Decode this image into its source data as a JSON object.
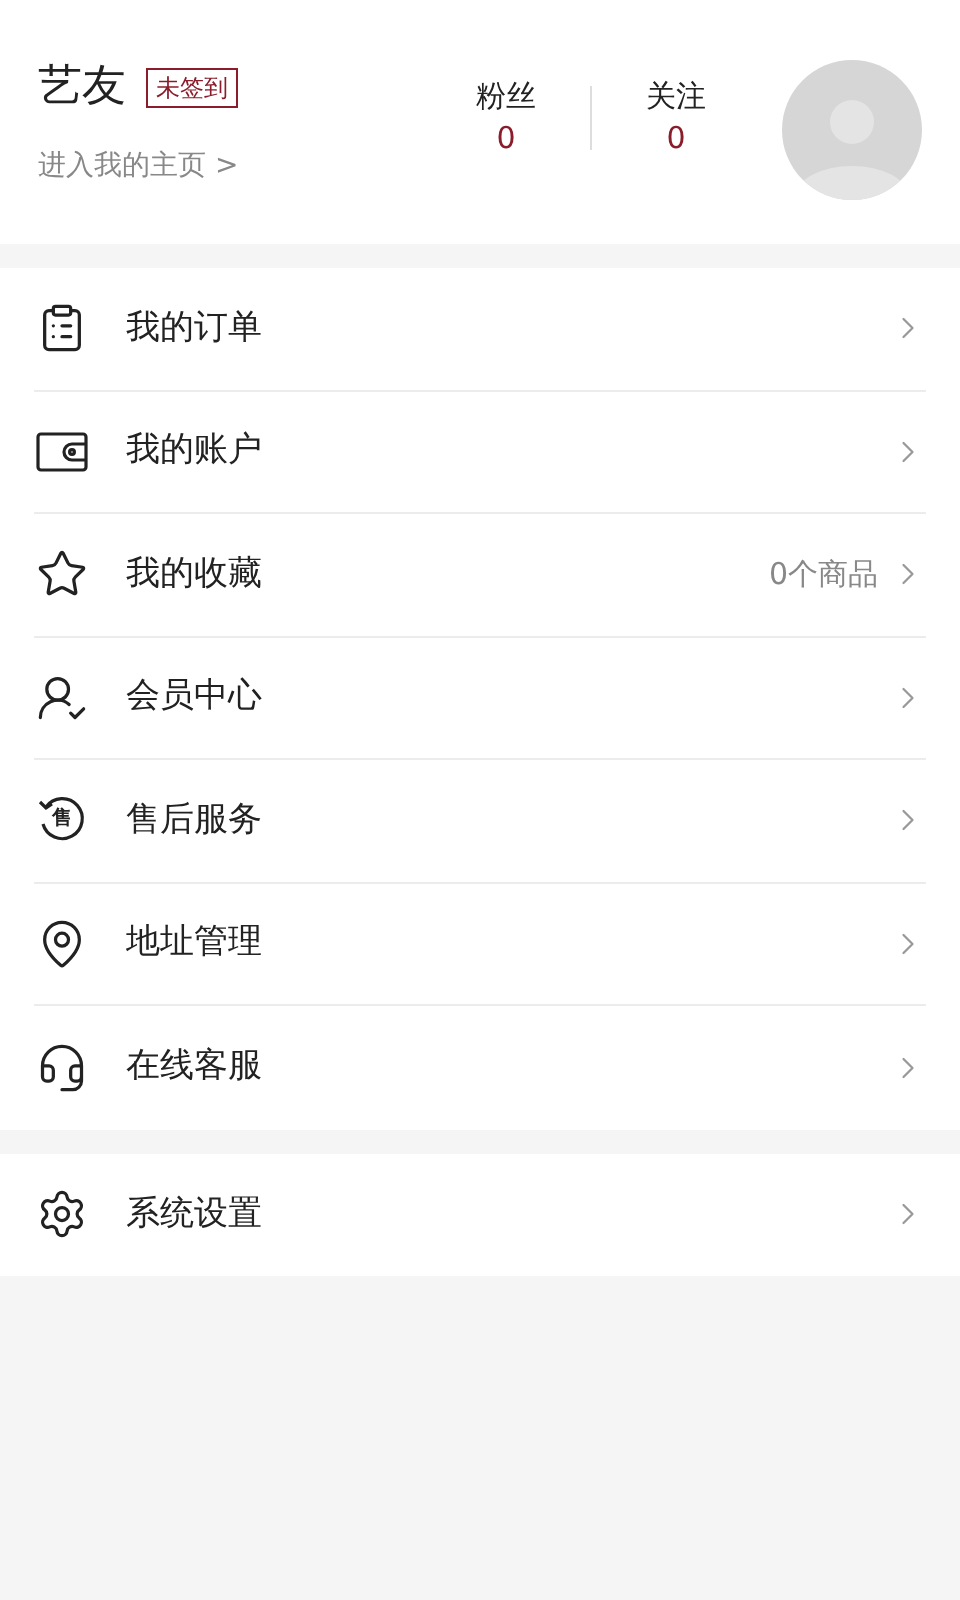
{
  "profile": {
    "name": "艺友",
    "badge": "未签到",
    "link": "进入我的主页 >",
    "stats": [
      {
        "label": "粉丝",
        "value": "0"
      },
      {
        "label": "关注",
        "value": "0"
      }
    ]
  },
  "menu_groups": [
    {
      "items": [
        {
          "kind": "clipboard",
          "label": "我的订单"
        },
        {
          "kind": "wallet",
          "label": "我的账户"
        },
        {
          "kind": "star",
          "label": "我的收藏",
          "detail": "0个商品"
        },
        {
          "kind": "member",
          "label": "会员中心"
        },
        {
          "kind": "aftersale",
          "icon_text": "售",
          "label": "售后服务"
        },
        {
          "kind": "location",
          "label": "地址管理"
        },
        {
          "kind": "headset",
          "label": "在线客服"
        }
      ]
    },
    {
      "items": [
        {
          "kind": "gear",
          "label": "系统设置"
        }
      ]
    }
  ]
}
